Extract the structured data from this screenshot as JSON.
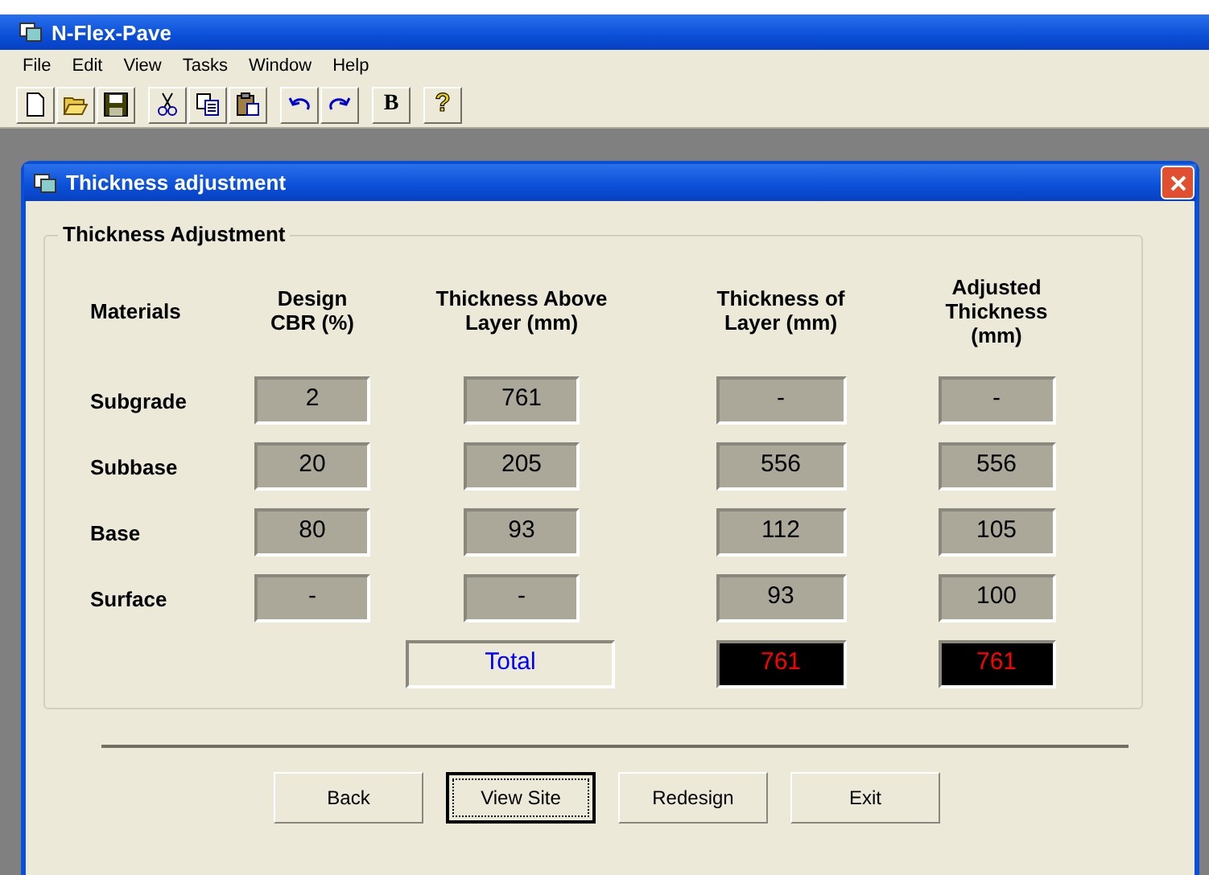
{
  "window": {
    "title": "N-Flex-Pave"
  },
  "menu": [
    "File",
    "Edit",
    "View",
    "Tasks",
    "Window",
    "Help"
  ],
  "toolbar": [
    [
      {
        "kind": "new"
      },
      {
        "kind": "open"
      },
      {
        "kind": "save"
      }
    ],
    [
      {
        "kind": "cut"
      },
      {
        "kind": "copy"
      },
      {
        "kind": "paste"
      }
    ],
    [
      {
        "kind": "undo"
      },
      {
        "kind": "redo"
      }
    ],
    [
      {
        "kind": "text",
        "label": "B"
      }
    ],
    [
      {
        "kind": "help",
        "label": "?"
      }
    ]
  ],
  "dialog": {
    "title": "Thickness adjustment",
    "group": {
      "title": "Thickness Adjustment",
      "columns": [
        "Materials",
        "Design\nCBR (%)",
        "Thickness Above\nLayer (mm)",
        "Thickness of\nLayer (mm)",
        "Adjusted\nThickness\n(mm)"
      ],
      "rows": [
        {
          "material": "Subgrade",
          "values": [
            "2",
            "761",
            "-",
            "-"
          ]
        },
        {
          "material": "Subbase",
          "values": [
            "20",
            "205",
            "556",
            "556"
          ]
        },
        {
          "material": "Base",
          "values": [
            "80",
            "93",
            "112",
            "105"
          ]
        },
        {
          "material": "Surface",
          "values": [
            "-",
            "-",
            "93",
            "100"
          ]
        }
      ],
      "total": {
        "label": "Total",
        "layer": "761",
        "adjusted": "761"
      }
    },
    "buttons": [
      {
        "label": "Back",
        "focused": false
      },
      {
        "label": "View Site",
        "focused": true
      },
      {
        "label": "Redesign",
        "focused": false
      },
      {
        "label": "Exit",
        "focused": false
      }
    ]
  }
}
